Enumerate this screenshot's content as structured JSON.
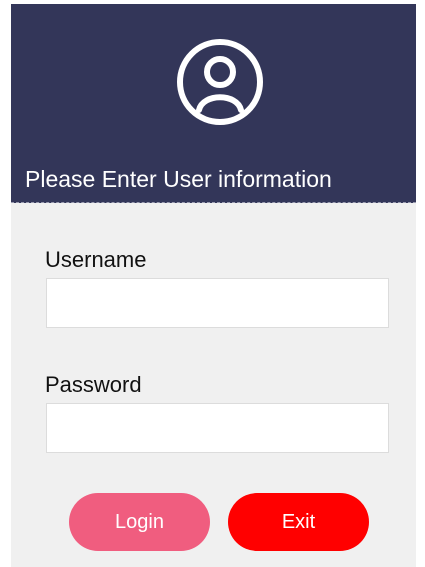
{
  "header": {
    "icon": "user-avatar-icon",
    "title": "Please Enter User information"
  },
  "form": {
    "username_label": "Username",
    "username_value": "",
    "password_label": "Password",
    "password_value": ""
  },
  "buttons": {
    "login_label": "Login",
    "exit_label": "Exit"
  },
  "colors": {
    "header_background": "#333659",
    "body_background": "#f0f0f0",
    "login_button": "#f05d7f",
    "exit_button": "#ff0000"
  }
}
